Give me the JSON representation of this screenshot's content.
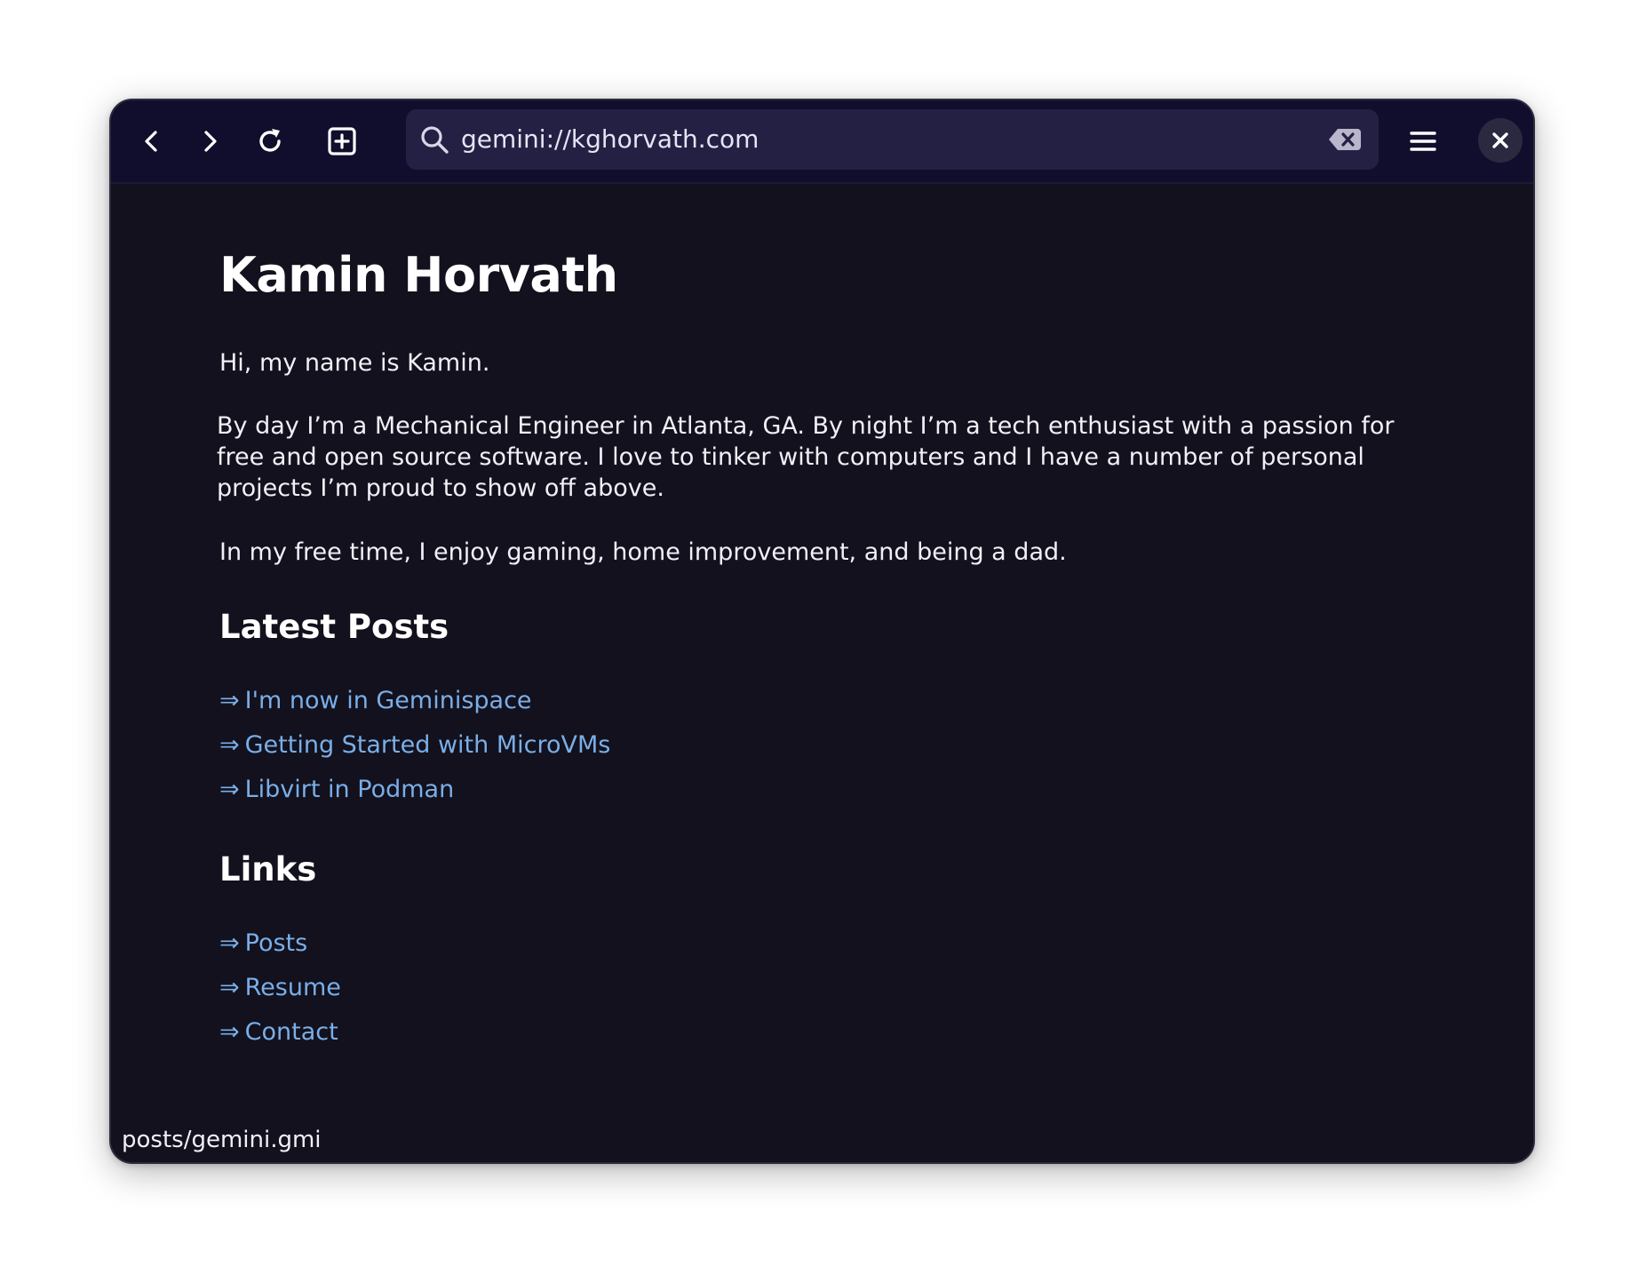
{
  "toolbar": {
    "url": "gemini://kghorvath.com",
    "back_icon": "chevron-left-icon",
    "forward_icon": "chevron-right-icon",
    "reload_icon": "reload-icon",
    "new_tab_icon": "plus-square-icon",
    "search_icon": "search-icon",
    "clear_icon": "backspace-clear-icon",
    "menu_icon": "hamburger-menu-icon",
    "close_icon": "close-icon"
  },
  "page": {
    "title": "Kamin Horvath",
    "intro": "Hi, my name is Kamin.",
    "about": "By day I’m a Mechanical Engineer in Atlanta, GA. By night I’m a tech enthusiast with a passion for free and open source software. I love to tinker with computers and I have a number of personal projects I’m proud to show off above.",
    "free_time": "In my free time, I enjoy gaming, home improvement, and being a dad.",
    "latest_posts_heading": "Latest Posts",
    "link_arrow": "⇒",
    "latest_posts": [
      {
        "label": "I'm now in Geminispace"
      },
      {
        "label": "Getting Started with MicroVMs"
      },
      {
        "label": "Libvirt in Podman"
      }
    ],
    "links_heading": "Links",
    "links": [
      {
        "label": "Posts"
      },
      {
        "label": "Resume"
      },
      {
        "label": "Contact"
      }
    ]
  },
  "status_bar": {
    "hover_link": "posts/gemini.gmi"
  },
  "colors": {
    "window_bg": "#12111d",
    "toolbar_bg": "#110e2d",
    "urlbar_bg": "#232044",
    "link": "#7aaee8",
    "text": "#f1f0f7"
  }
}
